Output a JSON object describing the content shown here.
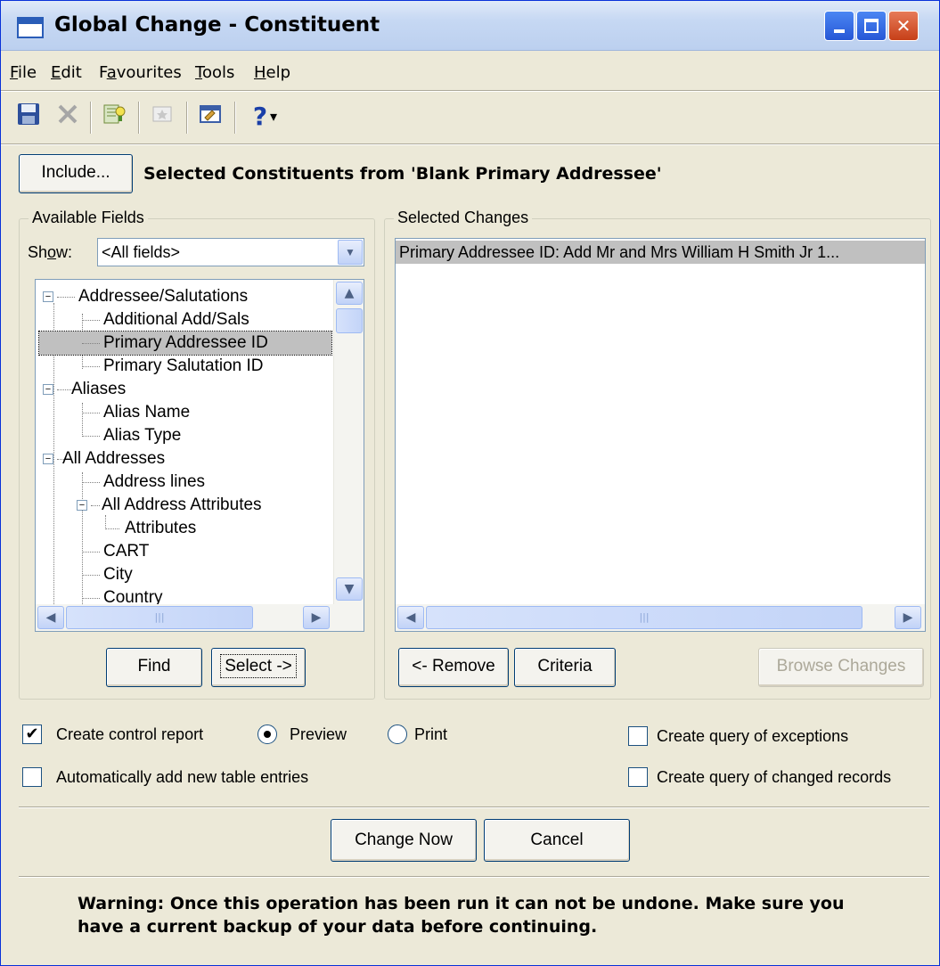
{
  "window": {
    "title": "Global Change - Constituent",
    "controls": {
      "minimize": "_",
      "maximize": "□",
      "close": "✕"
    }
  },
  "menu": [
    {
      "label": "File",
      "mnemonic": "F"
    },
    {
      "label": "Edit",
      "mnemonic": "E"
    },
    {
      "label": "Favourites",
      "mnemonic": "a"
    },
    {
      "label": "Tools",
      "mnemonic": "T"
    },
    {
      "label": "Help",
      "mnemonic": "H"
    }
  ],
  "toolbar": {
    "save_icon": "floppy-disk-icon",
    "delete_icon": "delete-x-icon",
    "criteria_icon": "tip-icon",
    "favourite_icon": "favourite-icon",
    "properties_icon": "properties-icon",
    "help_glyph": "?",
    "help_dropdown": "▾"
  },
  "include": {
    "button_label": "Include...",
    "description": "Selected Constituents from 'Blank Primary Addressee'"
  },
  "available_fields": {
    "label": "Available Fields",
    "show_label": "Show:",
    "show_value": "<All fields>",
    "tree": [
      {
        "text": "Addressee/Salutations",
        "level": 0,
        "expander": "−"
      },
      {
        "text": "Additional Add/Sals",
        "level": 1
      },
      {
        "text": "Primary Addressee ID",
        "level": 1,
        "selected": true
      },
      {
        "text": "Primary Salutation ID",
        "level": 1
      },
      {
        "text": "Aliases",
        "level": 0,
        "expander": "−"
      },
      {
        "text": "Alias Name",
        "level": 1
      },
      {
        "text": "Alias Type",
        "level": 1
      },
      {
        "text": "All Addresses",
        "level": 0,
        "expander": "−"
      },
      {
        "text": "Address lines",
        "level": 1
      },
      {
        "text": "All Address Attributes",
        "level": 1,
        "expander": "−"
      },
      {
        "text": "Attributes",
        "level": 2
      },
      {
        "text": "CART",
        "level": 1
      },
      {
        "text": "City",
        "level": 1
      },
      {
        "text": "Country",
        "level": 1
      }
    ],
    "find_button": "Find",
    "select_button": "Select ->"
  },
  "selected_changes": {
    "label": "Selected Changes",
    "items": [
      "Primary Addressee ID:  Add Mr and Mrs William H Smith Jr 1..."
    ],
    "remove_button": "<- Remove",
    "criteria_button": "Criteria",
    "browse_button": "Browse Changes"
  },
  "options": {
    "create_control_report": {
      "label": "Create control report",
      "checked": true
    },
    "preview": {
      "label": "Preview",
      "selected": true
    },
    "print": {
      "label": "Print",
      "selected": false
    },
    "create_query_exceptions": {
      "label": "Create query of exceptions",
      "checked": false
    },
    "auto_add_table_entries": {
      "label": "Automatically add new table entries",
      "checked": false
    },
    "create_query_changed": {
      "label": "Create query of changed records",
      "checked": false
    }
  },
  "actions": {
    "change_now": "Change Now",
    "cancel": "Cancel"
  },
  "warning": "Warning: Once this operation has been run it can not be undone. Make sure you have a current backup of your data before continuing.",
  "colors": {
    "dialog_bg": "#ece9d8",
    "titlebar_gradient_start": "#dfe9f8",
    "selected_row": "#c0c0c0",
    "close_button": "#c63f18"
  }
}
